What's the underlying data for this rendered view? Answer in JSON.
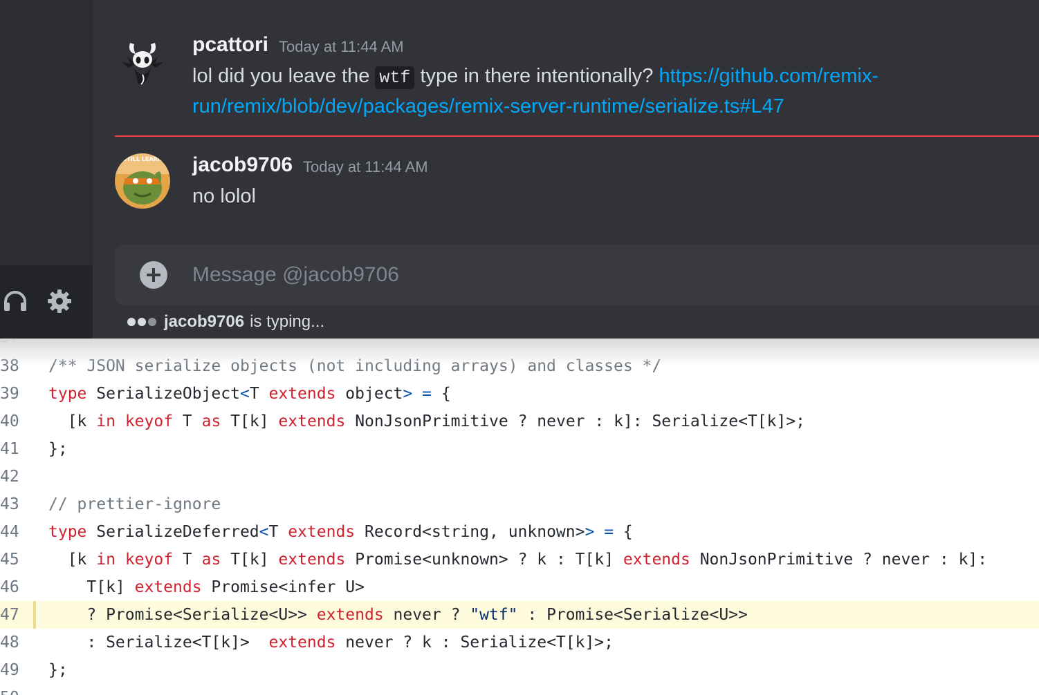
{
  "messages": [
    {
      "author": "pcattori",
      "timestamp": "Today at 11:44 AM",
      "text_before": "lol did you leave the ",
      "code": "wtf",
      "text_after": " type in there intentionally? ",
      "link_line1": "https://github.com/remix-",
      "link_line2": "run/remix/blob/dev/packages/remix-server-runtime/serialize.ts#L47"
    },
    {
      "author": "jacob9706",
      "timestamp": "Today at 11:44 AM",
      "avatar_caption": "STILL LEARN",
      "text": "no lolol"
    }
  ],
  "composer": {
    "placeholder": "Message @jacob9706"
  },
  "typing": {
    "user": "jacob9706",
    "suffix": "is typing..."
  },
  "colors": {
    "link": "#00a8fc",
    "divider": "#f23f43",
    "keyword": "#cf222e",
    "highlight": "#fffbdd"
  },
  "icons": [
    "headphones-icon",
    "gear-icon",
    "add-attachment-icon"
  ],
  "code_view": {
    "partial_top_line": "37",
    "partial_bottom_line": "50",
    "lines": [
      {
        "n": "38",
        "segments": [
          {
            "t": "/** JSON serialize objects (not including arrays) and classes */",
            "c": "cm"
          }
        ]
      },
      {
        "n": "39",
        "segments": [
          {
            "t": "type",
            "c": "kw"
          },
          {
            "t": " SerializeObject"
          },
          {
            "t": "<",
            "c": "op"
          },
          {
            "t": "T "
          },
          {
            "t": "extends",
            "c": "kw"
          },
          {
            "t": " object"
          },
          {
            "t": ">",
            "c": "op"
          },
          {
            "t": " "
          },
          {
            "t": "=",
            "c": "op"
          },
          {
            "t": " {"
          }
        ]
      },
      {
        "n": "40",
        "segments": [
          {
            "t": "  [k "
          },
          {
            "t": "in",
            "c": "kw"
          },
          {
            "t": " "
          },
          {
            "t": "keyof",
            "c": "kw"
          },
          {
            "t": " T "
          },
          {
            "t": "as",
            "c": "kw"
          },
          {
            "t": " T[k] "
          },
          {
            "t": "extends",
            "c": "kw"
          },
          {
            "t": " NonJsonPrimitive ? never : k]: Serialize<T[k]>;"
          }
        ]
      },
      {
        "n": "41",
        "segments": [
          {
            "t": "};"
          }
        ]
      },
      {
        "n": "42",
        "segments": []
      },
      {
        "n": "43",
        "segments": [
          {
            "t": "// prettier-ignore",
            "c": "cm"
          }
        ]
      },
      {
        "n": "44",
        "segments": [
          {
            "t": "type",
            "c": "kw"
          },
          {
            "t": " SerializeDeferred"
          },
          {
            "t": "<",
            "c": "op"
          },
          {
            "t": "T "
          },
          {
            "t": "extends",
            "c": "kw"
          },
          {
            "t": " Record<string, unknown>"
          },
          {
            "t": ">",
            "c": "op"
          },
          {
            "t": " "
          },
          {
            "t": "=",
            "c": "op"
          },
          {
            "t": " {"
          }
        ]
      },
      {
        "n": "45",
        "segments": [
          {
            "t": "  [k "
          },
          {
            "t": "in",
            "c": "kw"
          },
          {
            "t": " "
          },
          {
            "t": "keyof",
            "c": "kw"
          },
          {
            "t": " T "
          },
          {
            "t": "as",
            "c": "kw"
          },
          {
            "t": " T[k] "
          },
          {
            "t": "extends",
            "c": "kw"
          },
          {
            "t": " Promise<unknown> ? k : T[k] "
          },
          {
            "t": "extends",
            "c": "kw"
          },
          {
            "t": " NonJsonPrimitive ? never : k]:"
          }
        ]
      },
      {
        "n": "46",
        "segments": [
          {
            "t": "    T[k] "
          },
          {
            "t": "extends",
            "c": "kw"
          },
          {
            "t": " Promise<infer U>"
          }
        ]
      },
      {
        "n": "47",
        "highlight": true,
        "segments": [
          {
            "t": "    ? Promise<Serialize<U>> "
          },
          {
            "t": "extends",
            "c": "kw"
          },
          {
            "t": " never ? "
          },
          {
            "t": "\"wtf\"",
            "c": "str"
          },
          {
            "t": " : Promise<Serialize<U>>"
          }
        ]
      },
      {
        "n": "48",
        "segments": [
          {
            "t": "    : Serialize<T[k]>  "
          },
          {
            "t": "extends",
            "c": "kw"
          },
          {
            "t": " never ? k : Serialize<T[k]>;"
          }
        ]
      },
      {
        "n": "49",
        "segments": [
          {
            "t": "};"
          }
        ]
      }
    ]
  }
}
